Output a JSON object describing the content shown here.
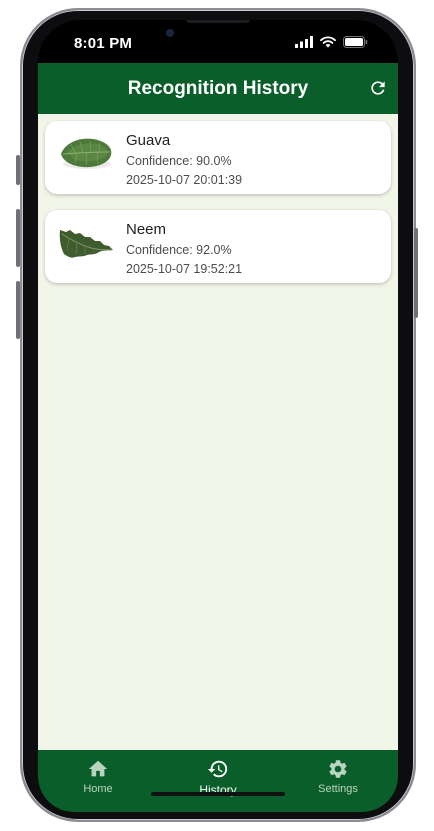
{
  "status_bar": {
    "time": "8:01 PM"
  },
  "app_bar": {
    "title": "Recognition History",
    "refresh_icon": "refresh-icon"
  },
  "history": [
    {
      "name": "Guava",
      "confidence": "Confidence: 90.0%",
      "timestamp": "2025-10-07 20:01:39",
      "thumbnail": "guava-leaf"
    },
    {
      "name": "Neem",
      "confidence": "Confidence: 92.0%",
      "timestamp": "2025-10-07 19:52:21",
      "thumbnail": "neem-leaf"
    }
  ],
  "bottom_nav": {
    "items": [
      {
        "label": "Home",
        "icon": "home-icon",
        "active": false
      },
      {
        "label": "History",
        "icon": "history-icon",
        "active": true
      },
      {
        "label": "Settings",
        "icon": "settings-icon",
        "active": false
      }
    ]
  },
  "colors": {
    "primary": "#0a5e2a",
    "background": "#f2f6e9",
    "card": "#ffffff"
  }
}
